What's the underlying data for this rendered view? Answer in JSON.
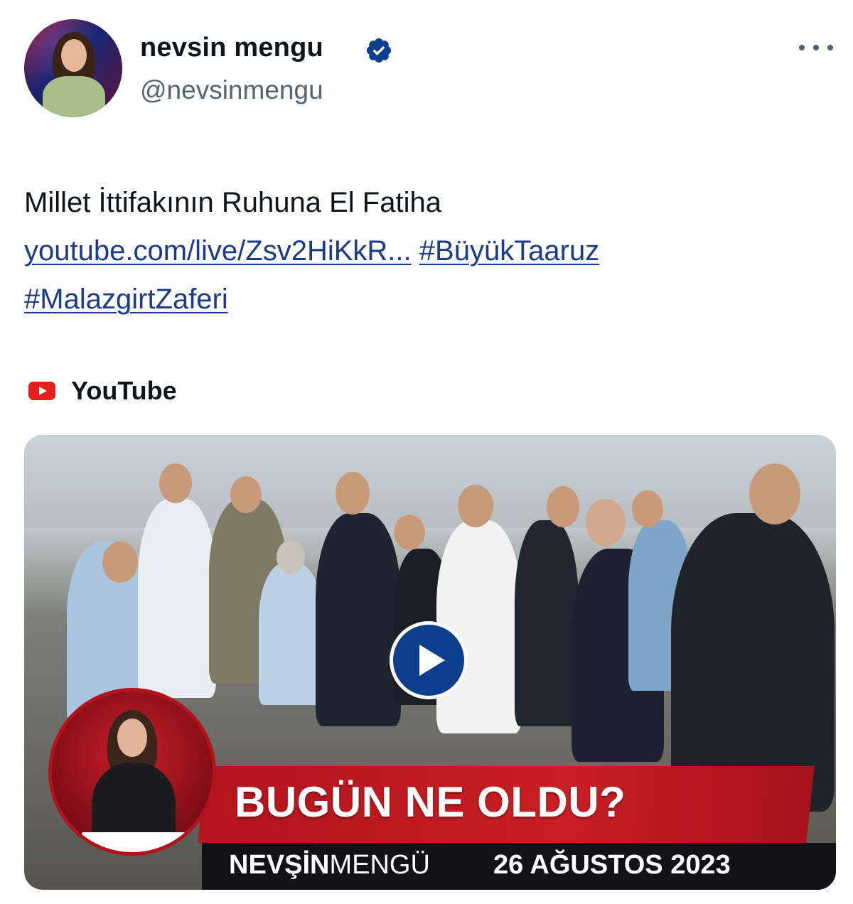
{
  "author": {
    "display_name": "nevsin mengu",
    "handle": "@nevsinmengu",
    "verified": true
  },
  "icons": {
    "avatar": "profile-photo",
    "verified": "verified-badge-icon",
    "more": "more-options-icon",
    "source": "youtube-logo-icon",
    "play": "play-icon"
  },
  "tweet": {
    "text": "Millet İttifakının Ruhuna El Fatiha",
    "link_text": "youtube.com/live/Zsv2HiKkR...",
    "hashtag_1": "#BüyükTaaruz",
    "hashtag_2": "#MalazgirtZaferi"
  },
  "link_card": {
    "source": "YouTube",
    "thumbnail": {
      "title": "BUGÜN NE OLDU?",
      "brand_bold": "NEVŞİN",
      "brand_light": "MENGÜ",
      "date": "26 AĞUSTOS 2023"
    }
  },
  "colors": {
    "text": "#0f1419",
    "secondary": "#536471",
    "link": "#1b3a8c",
    "verified": "#1d9bf0",
    "youtube_red": "#e8201b",
    "banner_red": "#c81f24"
  }
}
